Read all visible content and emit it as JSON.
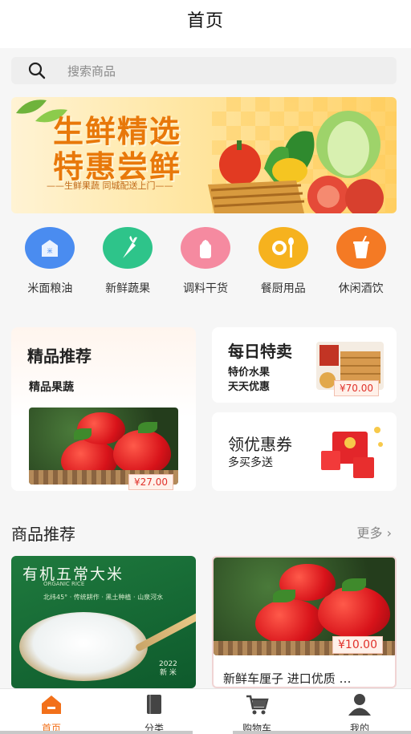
{
  "header": {
    "title": "首页"
  },
  "search": {
    "placeholder": "搜索商品"
  },
  "banner": {
    "line1": "生鲜精选",
    "line2": "特惠尝鲜",
    "sub": "——生鲜果蔬 同城配送上门——"
  },
  "categories": [
    {
      "label": "米面粮油",
      "color": "#4a8cf0",
      "icon": "rice-bag-icon"
    },
    {
      "label": "新鲜蔬果",
      "color": "#2ec48a",
      "icon": "carrot-icon"
    },
    {
      "label": "调料干货",
      "color": "#f58aa0",
      "icon": "salt-shaker-icon"
    },
    {
      "label": "餐厨用品",
      "color": "#f6b21e",
      "icon": "tableware-icon"
    },
    {
      "label": "休闲酒饮",
      "color": "#f47a24",
      "icon": "drink-cup-icon"
    }
  ],
  "promo": {
    "featured": {
      "title": "精品推荐",
      "subtitle": "精品果蔬",
      "price": "¥27.00"
    },
    "daily": {
      "title": "每日特卖",
      "line1": "特价水果",
      "line2": "天天优惠",
      "price": "¥70.00"
    },
    "coupon": {
      "title": "领优惠券",
      "line1": "多买多送"
    }
  },
  "products_section": {
    "title": "商品推荐",
    "more": "更多"
  },
  "products": [
    {
      "name": "有机五常大米",
      "en": "ORGANIC RICE",
      "desc": "北纬45° · 传统耕作 · 黑土种植 · 山泉河水",
      "year": "2022",
      "year_sub": "新 米"
    },
    {
      "name": "新鲜车厘子 进口优质 …",
      "price": "¥10.00"
    }
  ],
  "tabbar": [
    {
      "label": "首页",
      "icon": "home-icon",
      "active": true
    },
    {
      "label": "分类",
      "icon": "category-icon",
      "active": false
    },
    {
      "label": "购物车",
      "icon": "cart-icon",
      "active": false
    },
    {
      "label": "我的",
      "icon": "user-icon",
      "active": false
    }
  ],
  "colors": {
    "accent": "#f2701a",
    "price": "#e0312a"
  }
}
